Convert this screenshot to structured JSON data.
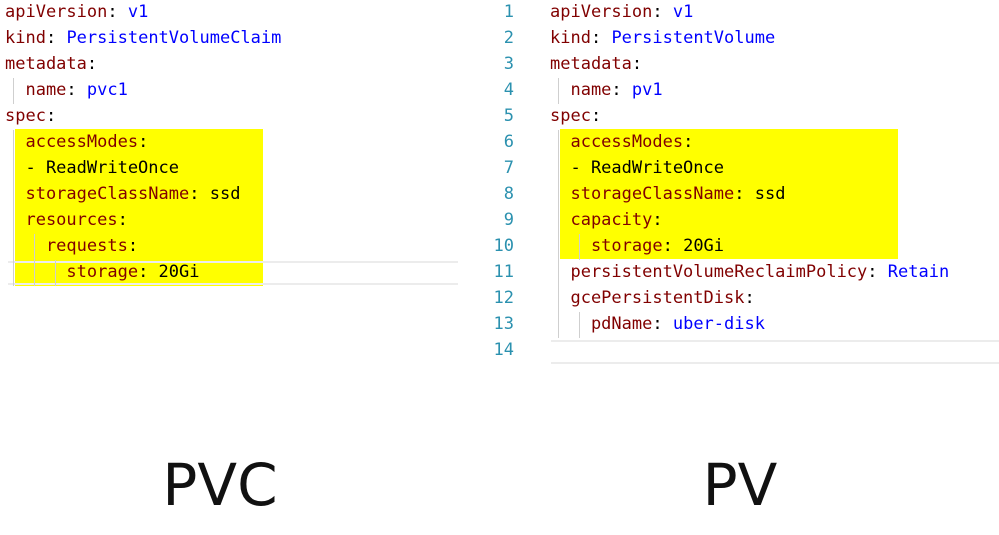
{
  "pvc": {
    "caption": "PVC",
    "lines": [
      {
        "key": "apiVersion",
        "sep": ":",
        "val": " v1"
      },
      {
        "key": "kind",
        "sep": ":",
        "val": " PersistentVolumeClaim"
      },
      {
        "key": "metadata",
        "sep": ":",
        "val": ""
      },
      {
        "key": "  name",
        "sep": ":",
        "val": " pvc1"
      },
      {
        "key": "spec",
        "sep": ":",
        "val": ""
      },
      {
        "key": "  accessModes",
        "sep": ":",
        "val": ""
      },
      {
        "key": "",
        "sep": "",
        "val": "",
        "txt": "  - ReadWriteOnce"
      },
      {
        "key": "  storageClassName",
        "sep": ":",
        "val": "",
        "txt": " ssd"
      },
      {
        "key": "  resources",
        "sep": ":",
        "val": ""
      },
      {
        "key": "    requests",
        "sep": ":",
        "val": ""
      },
      {
        "key": "      storage",
        "sep": ":",
        "val": "",
        "txt": " 20Gi"
      }
    ]
  },
  "pv": {
    "caption": "PV",
    "line_numbers": [
      "1",
      "2",
      "3",
      "4",
      "5",
      "6",
      "7",
      "8",
      "9",
      "10",
      "11",
      "12",
      "13",
      "14"
    ],
    "lines": [
      {
        "key": "apiVersion",
        "sep": ":",
        "val": " v1"
      },
      {
        "key": "kind",
        "sep": ":",
        "val": " PersistentVolume"
      },
      {
        "key": "metadata",
        "sep": ":",
        "val": ""
      },
      {
        "key": "  name",
        "sep": ":",
        "val": " pv1"
      },
      {
        "key": "spec",
        "sep": ":",
        "val": ""
      },
      {
        "key": "  accessModes",
        "sep": ":",
        "val": ""
      },
      {
        "key": "",
        "sep": "",
        "val": "",
        "txt": "  - ReadWriteOnce"
      },
      {
        "key": "  storageClassName",
        "sep": ":",
        "val": "",
        "txt": " ssd"
      },
      {
        "key": "  capacity",
        "sep": ":",
        "val": ""
      },
      {
        "key": "    storage",
        "sep": ":",
        "val": "",
        "txt": " 20Gi"
      },
      {
        "key": "  persistentVolumeReclaimPolicy",
        "sep": ":",
        "val": " Retain"
      },
      {
        "key": "  gcePersistentDisk",
        "sep": ":",
        "val": ""
      },
      {
        "key": "    pdName",
        "sep": ":",
        "val": " uber-disk"
      },
      {
        "key": "",
        "sep": "",
        "val": ""
      }
    ]
  },
  "colors": {
    "highlight": "#ffff00",
    "key": "#800000",
    "value": "#0000ff",
    "line_number": "#2b91af"
  }
}
